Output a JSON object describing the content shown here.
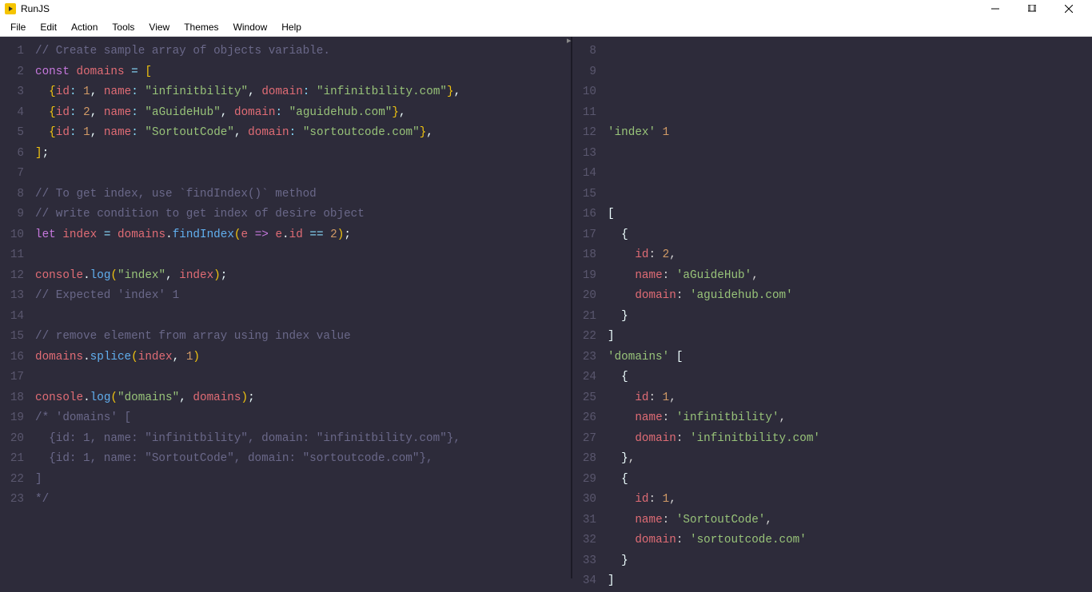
{
  "app": {
    "title": "RunJS"
  },
  "menu": [
    "File",
    "Edit",
    "Action",
    "Tools",
    "View",
    "Themes",
    "Window",
    "Help"
  ],
  "left_code": [
    {
      "n": 1,
      "tokens": [
        [
          "cm",
          "// Create sample array of objects variable."
        ]
      ]
    },
    {
      "n": 2,
      "tokens": [
        [
          "kw",
          "const"
        ],
        [
          "pl",
          " "
        ],
        [
          "vr",
          "domains"
        ],
        [
          "pl",
          " "
        ],
        [
          "op",
          "="
        ],
        [
          "pl",
          " "
        ],
        [
          "pn2",
          "["
        ]
      ]
    },
    {
      "n": 3,
      "tokens": [
        [
          "pl",
          "  "
        ],
        [
          "pn2",
          "{"
        ],
        [
          "pr",
          "id"
        ],
        [
          "op",
          ":"
        ],
        [
          "pl",
          " "
        ],
        [
          "nu",
          "1"
        ],
        [
          "pn",
          ","
        ],
        [
          "pl",
          " "
        ],
        [
          "pr",
          "name"
        ],
        [
          "op",
          ":"
        ],
        [
          "pl",
          " "
        ],
        [
          "st",
          "\"infinitbility\""
        ],
        [
          "pn",
          ","
        ],
        [
          "pl",
          " "
        ],
        [
          "pr",
          "domain"
        ],
        [
          "op",
          ":"
        ],
        [
          "pl",
          " "
        ],
        [
          "st",
          "\"infinitbility.com\""
        ],
        [
          "pn2",
          "}"
        ],
        [
          "pn",
          ","
        ]
      ]
    },
    {
      "n": 4,
      "tokens": [
        [
          "pl",
          "  "
        ],
        [
          "pn2",
          "{"
        ],
        [
          "pr",
          "id"
        ],
        [
          "op",
          ":"
        ],
        [
          "pl",
          " "
        ],
        [
          "nu",
          "2"
        ],
        [
          "pn",
          ","
        ],
        [
          "pl",
          " "
        ],
        [
          "pr",
          "name"
        ],
        [
          "op",
          ":"
        ],
        [
          "pl",
          " "
        ],
        [
          "st",
          "\"aGuideHub\""
        ],
        [
          "pn",
          ","
        ],
        [
          "pl",
          " "
        ],
        [
          "pr",
          "domain"
        ],
        [
          "op",
          ":"
        ],
        [
          "pl",
          " "
        ],
        [
          "st",
          "\"aguidehub.com\""
        ],
        [
          "pn2",
          "}"
        ],
        [
          "pn",
          ","
        ]
      ]
    },
    {
      "n": 5,
      "tokens": [
        [
          "pl",
          "  "
        ],
        [
          "pn2",
          "{"
        ],
        [
          "pr",
          "id"
        ],
        [
          "op",
          ":"
        ],
        [
          "pl",
          " "
        ],
        [
          "nu",
          "1"
        ],
        [
          "pn",
          ","
        ],
        [
          "pl",
          " "
        ],
        [
          "pr",
          "name"
        ],
        [
          "op",
          ":"
        ],
        [
          "pl",
          " "
        ],
        [
          "st",
          "\"SortoutCode\""
        ],
        [
          "pn",
          ","
        ],
        [
          "pl",
          " "
        ],
        [
          "pr",
          "domain"
        ],
        [
          "op",
          ":"
        ],
        [
          "pl",
          " "
        ],
        [
          "st",
          "\"sortoutcode.com\""
        ],
        [
          "pn2",
          "}"
        ],
        [
          "pn",
          ","
        ]
      ]
    },
    {
      "n": 6,
      "tokens": [
        [
          "pn2",
          "]"
        ],
        [
          "pn",
          ";"
        ]
      ]
    },
    {
      "n": 7,
      "tokens": [
        [
          "pl",
          ""
        ]
      ]
    },
    {
      "n": 8,
      "tokens": [
        [
          "cm",
          "// To get index, use `findIndex()` method"
        ]
      ]
    },
    {
      "n": 9,
      "tokens": [
        [
          "cm",
          "// write condition to get index of desire object"
        ]
      ]
    },
    {
      "n": 10,
      "tokens": [
        [
          "kw",
          "let"
        ],
        [
          "pl",
          " "
        ],
        [
          "vr",
          "index"
        ],
        [
          "pl",
          " "
        ],
        [
          "op",
          "="
        ],
        [
          "pl",
          " "
        ],
        [
          "vr",
          "domains"
        ],
        [
          "pn",
          "."
        ],
        [
          "fn",
          "findIndex"
        ],
        [
          "pn2",
          "("
        ],
        [
          "vr",
          "e"
        ],
        [
          "pl",
          " "
        ],
        [
          "kw2",
          "=>"
        ],
        [
          "pl",
          " "
        ],
        [
          "vr",
          "e"
        ],
        [
          "pn",
          "."
        ],
        [
          "pr",
          "id"
        ],
        [
          "pl",
          " "
        ],
        [
          "op",
          "=="
        ],
        [
          "pl",
          " "
        ],
        [
          "nu",
          "2"
        ],
        [
          "pn2",
          ")"
        ],
        [
          "pn",
          ";"
        ]
      ]
    },
    {
      "n": 11,
      "tokens": [
        [
          "pl",
          ""
        ]
      ]
    },
    {
      "n": 12,
      "tokens": [
        [
          "vr",
          "console"
        ],
        [
          "pn",
          "."
        ],
        [
          "fn",
          "log"
        ],
        [
          "pn2",
          "("
        ],
        [
          "st",
          "\"index\""
        ],
        [
          "pn",
          ","
        ],
        [
          "pl",
          " "
        ],
        [
          "vr",
          "index"
        ],
        [
          "pn2",
          ")"
        ],
        [
          "pn",
          ";"
        ]
      ]
    },
    {
      "n": 13,
      "tokens": [
        [
          "cm",
          "// Expected 'index' 1"
        ]
      ]
    },
    {
      "n": 14,
      "tokens": [
        [
          "pl",
          ""
        ]
      ]
    },
    {
      "n": 15,
      "tokens": [
        [
          "cm",
          "// remove element from array using index value"
        ]
      ]
    },
    {
      "n": 16,
      "tokens": [
        [
          "vr",
          "domains"
        ],
        [
          "pn",
          "."
        ],
        [
          "fn",
          "splice"
        ],
        [
          "pn2",
          "("
        ],
        [
          "vr",
          "index"
        ],
        [
          "pn",
          ","
        ],
        [
          "pl",
          " "
        ],
        [
          "nu",
          "1"
        ],
        [
          "pn2",
          ")"
        ]
      ]
    },
    {
      "n": 17,
      "tokens": [
        [
          "pl",
          ""
        ]
      ]
    },
    {
      "n": 18,
      "tokens": [
        [
          "vr",
          "console"
        ],
        [
          "pn",
          "."
        ],
        [
          "fn",
          "log"
        ],
        [
          "pn2",
          "("
        ],
        [
          "st",
          "\"domains\""
        ],
        [
          "pn",
          ","
        ],
        [
          "pl",
          " "
        ],
        [
          "vr",
          "domains"
        ],
        [
          "pn2",
          ")"
        ],
        [
          "pn",
          ";"
        ]
      ]
    },
    {
      "n": 19,
      "tokens": [
        [
          "cm",
          "/* 'domains' ["
        ]
      ]
    },
    {
      "n": 20,
      "tokens": [
        [
          "cm",
          "  {id: 1, name: \"infinitbility\", domain: \"infinitbility.com\"},"
        ]
      ]
    },
    {
      "n": 21,
      "tokens": [
        [
          "cm",
          "  {id: 1, name: \"SortoutCode\", domain: \"sortoutcode.com\"},"
        ]
      ]
    },
    {
      "n": 22,
      "tokens": [
        [
          "cm",
          "]"
        ]
      ]
    },
    {
      "n": 23,
      "tokens": [
        [
          "cm",
          "*/"
        ]
      ]
    }
  ],
  "right_output": [
    {
      "n": 8,
      "tokens": [
        [
          "o-pn",
          ""
        ]
      ]
    },
    {
      "n": 9,
      "tokens": [
        [
          "o-pn",
          ""
        ]
      ]
    },
    {
      "n": 10,
      "tokens": [
        [
          "o-pn",
          ""
        ]
      ]
    },
    {
      "n": 11,
      "tokens": [
        [
          "o-pn",
          ""
        ]
      ]
    },
    {
      "n": 12,
      "tokens": [
        [
          "o-str",
          "'index'"
        ],
        [
          "o-pn",
          " "
        ],
        [
          "o-num",
          "1"
        ]
      ]
    },
    {
      "n": 13,
      "tokens": [
        [
          "o-pn",
          ""
        ]
      ]
    },
    {
      "n": 14,
      "tokens": [
        [
          "o-pn",
          ""
        ]
      ]
    },
    {
      "n": 15,
      "tokens": [
        [
          "o-pn",
          ""
        ]
      ]
    },
    {
      "n": 16,
      "tokens": [
        [
          "o-br",
          "["
        ]
      ]
    },
    {
      "n": 17,
      "tokens": [
        [
          "o-pn",
          "  "
        ],
        [
          "o-br",
          "{"
        ]
      ]
    },
    {
      "n": 18,
      "tokens": [
        [
          "o-pn",
          "    "
        ],
        [
          "o-key",
          "id"
        ],
        [
          "o-pn",
          ": "
        ],
        [
          "o-num",
          "2"
        ],
        [
          "o-pn",
          ","
        ]
      ]
    },
    {
      "n": 19,
      "tokens": [
        [
          "o-pn",
          "    "
        ],
        [
          "o-key",
          "name"
        ],
        [
          "o-pn",
          ": "
        ],
        [
          "o-str",
          "'aGuideHub'"
        ],
        [
          "o-pn",
          ","
        ]
      ]
    },
    {
      "n": 20,
      "tokens": [
        [
          "o-pn",
          "    "
        ],
        [
          "o-key",
          "domain"
        ],
        [
          "o-pn",
          ": "
        ],
        [
          "o-str",
          "'aguidehub.com'"
        ]
      ]
    },
    {
      "n": 21,
      "tokens": [
        [
          "o-pn",
          "  "
        ],
        [
          "o-br",
          "}"
        ]
      ]
    },
    {
      "n": 22,
      "tokens": [
        [
          "o-br",
          "]"
        ]
      ]
    },
    {
      "n": 23,
      "tokens": [
        [
          "o-str",
          "'domains'"
        ],
        [
          "o-pn",
          " "
        ],
        [
          "o-br",
          "["
        ]
      ]
    },
    {
      "n": 24,
      "tokens": [
        [
          "o-pn",
          "  "
        ],
        [
          "o-br",
          "{"
        ]
      ]
    },
    {
      "n": 25,
      "tokens": [
        [
          "o-pn",
          "    "
        ],
        [
          "o-key",
          "id"
        ],
        [
          "o-pn",
          ": "
        ],
        [
          "o-num",
          "1"
        ],
        [
          "o-pn",
          ","
        ]
      ]
    },
    {
      "n": 26,
      "tokens": [
        [
          "o-pn",
          "    "
        ],
        [
          "o-key",
          "name"
        ],
        [
          "o-pn",
          ": "
        ],
        [
          "o-str",
          "'infinitbility'"
        ],
        [
          "o-pn",
          ","
        ]
      ]
    },
    {
      "n": 27,
      "tokens": [
        [
          "o-pn",
          "    "
        ],
        [
          "o-key",
          "domain"
        ],
        [
          "o-pn",
          ": "
        ],
        [
          "o-str",
          "'infinitbility.com'"
        ]
      ]
    },
    {
      "n": 28,
      "tokens": [
        [
          "o-pn",
          "  "
        ],
        [
          "o-br",
          "}"
        ],
        [
          "o-pn",
          ","
        ]
      ]
    },
    {
      "n": 29,
      "tokens": [
        [
          "o-pn",
          "  "
        ],
        [
          "o-br",
          "{"
        ]
      ]
    },
    {
      "n": 30,
      "tokens": [
        [
          "o-pn",
          "    "
        ],
        [
          "o-key",
          "id"
        ],
        [
          "o-pn",
          ": "
        ],
        [
          "o-num",
          "1"
        ],
        [
          "o-pn",
          ","
        ]
      ]
    },
    {
      "n": 31,
      "tokens": [
        [
          "o-pn",
          "    "
        ],
        [
          "o-key",
          "name"
        ],
        [
          "o-pn",
          ": "
        ],
        [
          "o-str",
          "'SortoutCode'"
        ],
        [
          "o-pn",
          ","
        ]
      ]
    },
    {
      "n": 32,
      "tokens": [
        [
          "o-pn",
          "    "
        ],
        [
          "o-key",
          "domain"
        ],
        [
          "o-pn",
          ": "
        ],
        [
          "o-str",
          "'sortoutcode.com'"
        ]
      ]
    },
    {
      "n": 33,
      "tokens": [
        [
          "o-pn",
          "  "
        ],
        [
          "o-br",
          "}"
        ]
      ]
    },
    {
      "n": 34,
      "tokens": [
        [
          "o-br",
          "]"
        ]
      ]
    }
  ]
}
